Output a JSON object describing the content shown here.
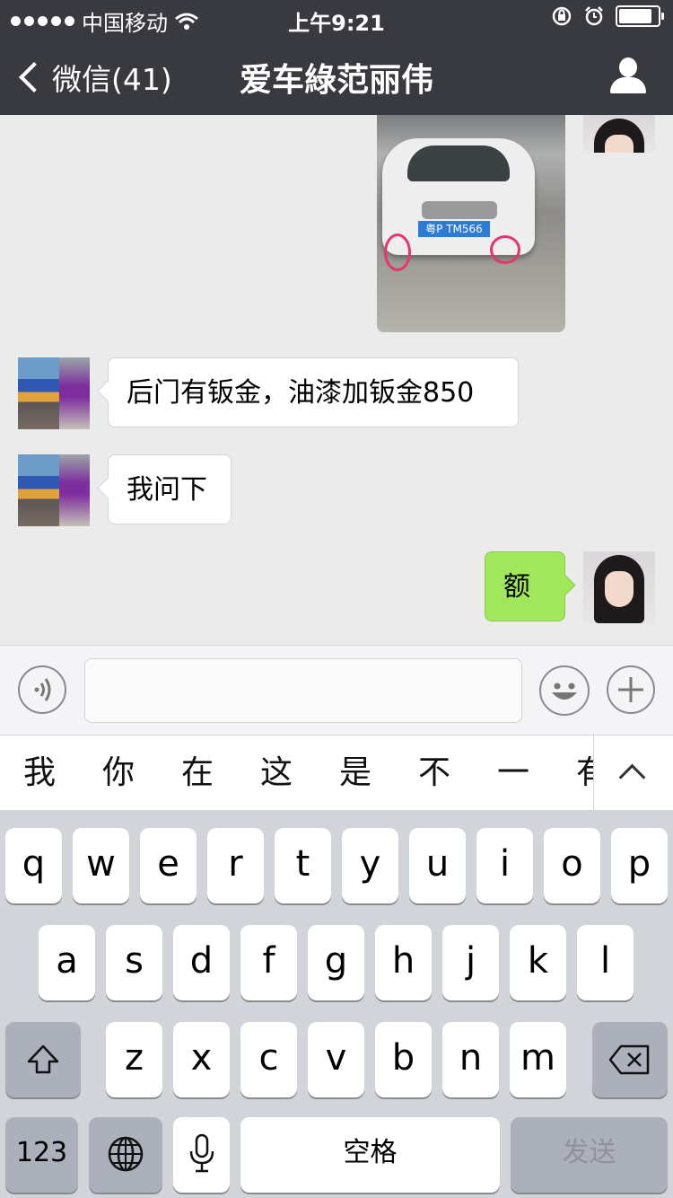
{
  "status_bar": {
    "carrier": "中国移动",
    "time": "上午9:21"
  },
  "nav": {
    "back_label": "微信(41)",
    "title": "爱车綠范丽伟"
  },
  "messages": [
    {
      "side": "right",
      "type": "image",
      "plate_text": "粤P TM566"
    },
    {
      "side": "left",
      "type": "text",
      "text": "后门有钣金，油漆加钣金850"
    },
    {
      "side": "left",
      "type": "text",
      "text": "我问下"
    },
    {
      "side": "right",
      "type": "text",
      "text": "额"
    }
  ],
  "input_bar": {
    "message_value": ""
  },
  "candidates": [
    "我",
    "你",
    "在",
    "这",
    "是",
    "不",
    "一",
    "有"
  ],
  "keyboard": {
    "row1": [
      "q",
      "w",
      "e",
      "r",
      "t",
      "y",
      "u",
      "i",
      "o",
      "p"
    ],
    "row2": [
      "a",
      "s",
      "d",
      "f",
      "g",
      "h",
      "j",
      "k",
      "l"
    ],
    "row3": [
      "z",
      "x",
      "c",
      "v",
      "b",
      "n",
      "m"
    ],
    "numbers_key": "123",
    "space_key": "空格",
    "send_key": "发送"
  },
  "colors": {
    "header_bg": "#393a3f",
    "chat_bg": "#ebebeb",
    "sent_bubble": "#a0e75a",
    "keyboard_bg": "#d1d4d9"
  }
}
